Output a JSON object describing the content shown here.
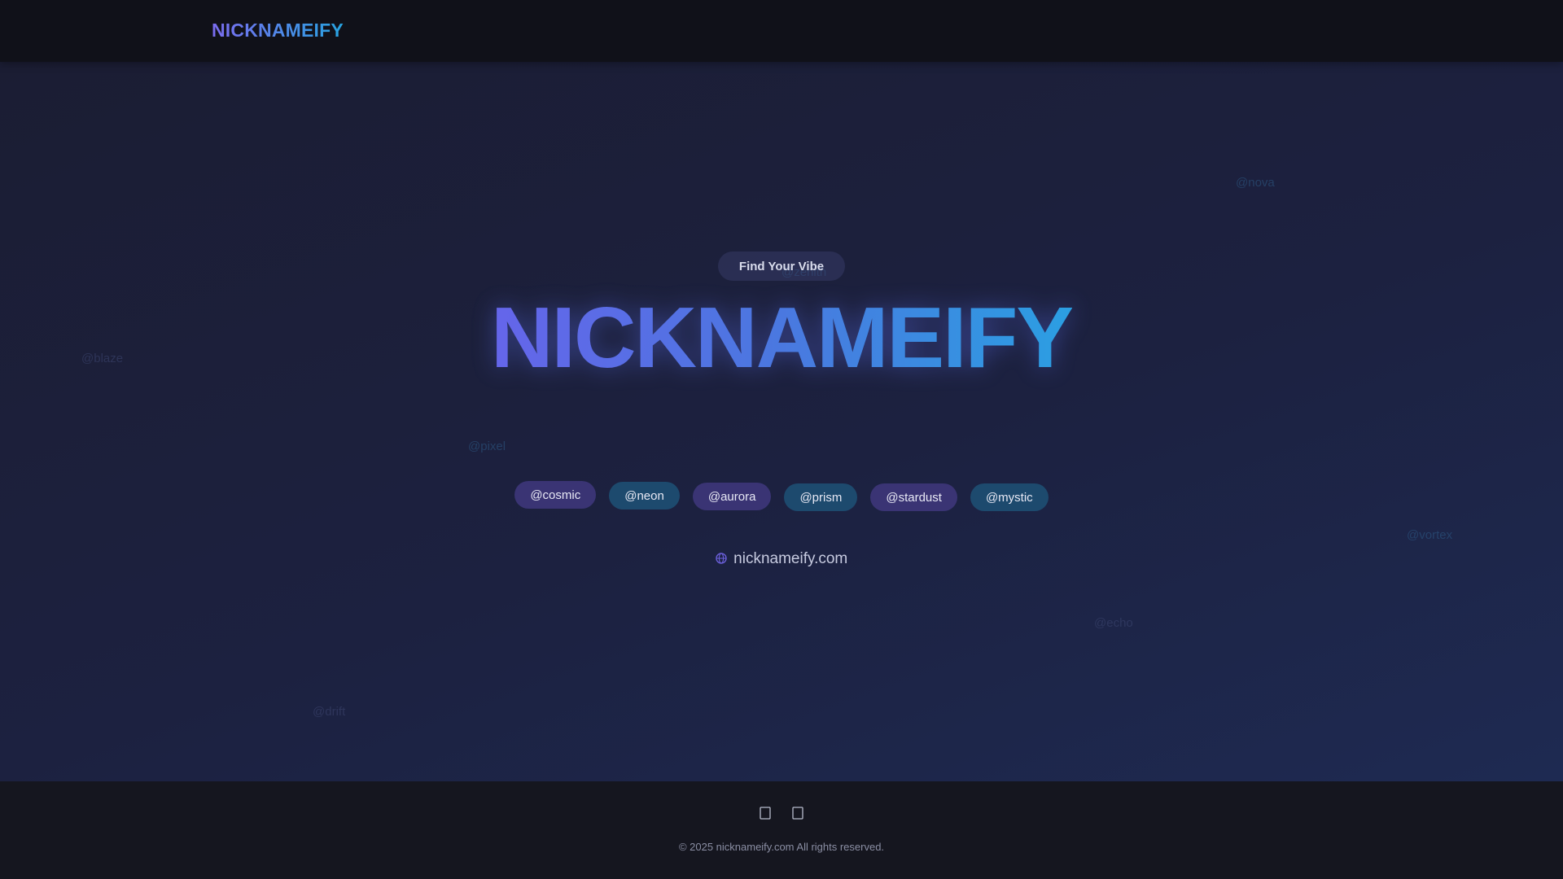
{
  "header": {
    "logo": "NICKNAMEIFY"
  },
  "hero": {
    "badge": "Find Your Vibe",
    "title": "NICKNAMEIFY",
    "tags": [
      {
        "label": "@cosmic",
        "tone": "purple"
      },
      {
        "label": "@neon",
        "tone": "teal"
      },
      {
        "label": "@aurora",
        "tone": "purple"
      },
      {
        "label": "@prism",
        "tone": "teal"
      },
      {
        "label": "@stardust",
        "tone": "purple"
      },
      {
        "label": "@mystic",
        "tone": "teal"
      }
    ],
    "domain": "nicknameify.com",
    "domain_icon": "globe-icon",
    "floaters": [
      "@zenith",
      "@nova",
      "@blaze",
      "@pixel",
      "@vortex",
      "@echo",
      "@drift"
    ]
  },
  "footer": {
    "social_icons": [
      "x-twitter-icon",
      "instagram-icon"
    ],
    "copyright": "© 2025 nicknameify.com All rights reserved."
  },
  "colors": {
    "brand_start": "#7b6cf0",
    "brand_end": "#27a3e0",
    "tag_purple": "#3a3474",
    "tag_teal": "#1d4a6e"
  }
}
